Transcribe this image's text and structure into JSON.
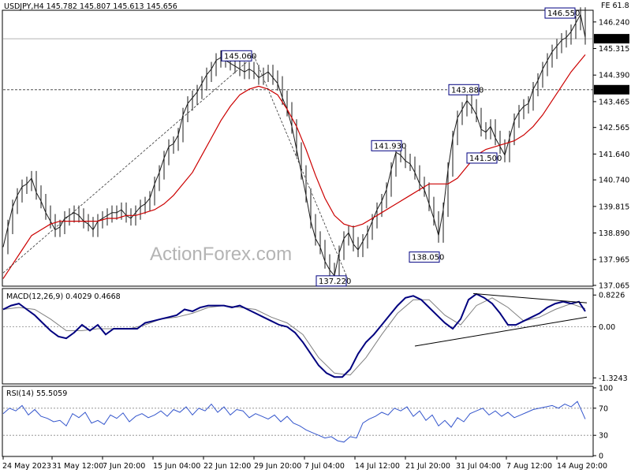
{
  "header": {
    "title": "USDJPY,H4  145.782 145.807 145.613 145.656",
    "fe_label": "FE 61.8"
  },
  "watermark": "ActionForex.com",
  "colors": {
    "price": "#1a1a1a",
    "ma": "#cc0000",
    "macd": "#00007f",
    "macd_signal": "#808080",
    "rsi": "#3355cc",
    "callout_border": "#000080"
  },
  "chart_data": [
    {
      "type": "line",
      "title": "USDJPY,H4",
      "ohlc_last": {
        "open": 145.782,
        "high": 145.807,
        "low": 145.613,
        "close": 145.656
      },
      "ylim": [
        137.065,
        146.62
      ],
      "yticks": [
        {
          "v": 146.24,
          "label": "146.240"
        },
        {
          "v": 145.315,
          "label": "145.315"
        },
        {
          "v": 144.39,
          "label": "144.390"
        },
        {
          "v": 143.465,
          "label": "143.465"
        },
        {
          "v": 142.565,
          "label": "142.565"
        },
        {
          "v": 141.64,
          "label": "141.640"
        },
        {
          "v": 140.74,
          "label": "140.740"
        },
        {
          "v": 139.815,
          "label": "139.815"
        },
        {
          "v": 138.89,
          "label": "138.890"
        },
        {
          "v": 137.965,
          "label": "137.965"
        },
        {
          "v": 137.065,
          "label": "137.065"
        }
      ],
      "price_labels": [
        {
          "v": 145.656,
          "label": "145.656"
        },
        {
          "v": 143.88,
          "label": "143.880"
        }
      ],
      "xlabels": [
        "24 May 2023",
        "31 May 12:00",
        "7 Jun 20:00",
        "15 Jun 04:00",
        "22 Jun 12:00",
        "29 Jun 20:00",
        "7 Jul 04:00",
        "14 Jul 12:00",
        "21 Jul 20:00",
        "31 Jul 04:00",
        "7 Aug 12:00",
        "14 Aug 20:00"
      ],
      "callouts": [
        {
          "label": "145.060",
          "v": 145.06
        },
        {
          "label": "137.220",
          "v": 137.22
        },
        {
          "label": "141.930",
          "v": 141.93
        },
        {
          "label": "138.050",
          "v": 138.05
        },
        {
          "label": "143.880",
          "v": 143.88
        },
        {
          "label": "141.500",
          "v": 141.5
        },
        {
          "label": "146.550",
          "v": 146.55
        }
      ],
      "series": [
        {
          "name": "USDJPY",
          "x": [
            0,
            6,
            12,
            18,
            24,
            30,
            36,
            42,
            48,
            54,
            60,
            66,
            72,
            78,
            84,
            90,
            96,
            102,
            108,
            114,
            120,
            126,
            132,
            138,
            144,
            150,
            156,
            162,
            168,
            174,
            180,
            186,
            192,
            198,
            204,
            210,
            216,
            222,
            228,
            234,
            240,
            246,
            252,
            258,
            264,
            270,
            276,
            282,
            288,
            294,
            300,
            306,
            312,
            318,
            324,
            330,
            336,
            342,
            348,
            354,
            360,
            366,
            372,
            378,
            384,
            390,
            396,
            402,
            408,
            414,
            420,
            426,
            432,
            438,
            444,
            450,
            456,
            462,
            468,
            474,
            480,
            486,
            492,
            498,
            504,
            510,
            516,
            522,
            528,
            534,
            540,
            546,
            552,
            558,
            564,
            570,
            576,
            582,
            588,
            594,
            600,
            606,
            612,
            618,
            624,
            630,
            636,
            642,
            648,
            654,
            660,
            666,
            672,
            678,
            684,
            690,
            696,
            702,
            708,
            714,
            720,
            726,
            732,
            738
          ],
          "values": [
            138.4,
            139.1,
            139.8,
            140.2,
            140.5,
            140.6,
            140.8,
            140.3,
            140.0,
            139.6,
            139.3,
            139.0,
            139.1,
            139.4,
            139.5,
            139.6,
            139.5,
            139.3,
            139.2,
            139.0,
            139.3,
            139.4,
            139.5,
            139.6,
            139.6,
            139.7,
            139.5,
            139.4,
            139.6,
            139.8,
            139.9,
            140.1,
            140.6,
            141.0,
            141.5,
            141.9,
            142.0,
            142.3,
            143.0,
            143.4,
            143.6,
            143.8,
            144.1,
            144.4,
            144.6,
            144.9,
            145.0,
            144.9,
            144.8,
            144.7,
            144.6,
            144.5,
            144.6,
            144.5,
            144.3,
            144.4,
            144.5,
            144.3,
            144.1,
            143.6,
            143.2,
            142.6,
            141.8,
            141.0,
            140.2,
            139.3,
            138.7,
            138.4,
            137.9,
            137.6,
            137.4,
            138.2,
            138.7,
            138.9,
            138.5,
            138.3,
            138.6,
            138.9,
            139.3,
            139.7,
            140.0,
            140.4,
            141.1,
            141.7,
            141.6,
            141.4,
            141.3,
            141.0,
            140.6,
            140.4,
            139.9,
            139.4,
            138.8,
            139.7,
            141.1,
            142.2,
            142.9,
            143.2,
            143.5,
            143.3,
            143.0,
            142.5,
            142.4,
            142.6,
            142.2,
            141.9,
            141.6,
            142.2,
            142.8,
            143.1,
            143.3,
            143.4,
            143.9,
            144.2,
            144.6,
            144.9,
            145.2,
            145.4,
            145.6,
            145.7,
            145.9,
            146.2,
            146.5,
            145.7
          ]
        },
        {
          "name": "MA",
          "x": [
            0,
            12,
            24,
            36,
            48,
            60,
            72,
            84,
            96,
            108,
            120,
            132,
            144,
            156,
            168,
            180,
            192,
            204,
            216,
            228,
            240,
            252,
            264,
            276,
            288,
            300,
            312,
            324,
            336,
            348,
            360,
            372,
            384,
            396,
            408,
            420,
            432,
            444,
            456,
            468,
            480,
            492,
            504,
            516,
            528,
            540,
            552,
            564,
            576,
            588,
            600,
            612,
            624,
            636,
            648,
            660,
            672,
            684,
            696,
            708,
            720,
            732,
            738
          ],
          "values": [
            137.3,
            137.8,
            138.3,
            138.8,
            139.0,
            139.2,
            139.3,
            139.3,
            139.3,
            139.3,
            139.3,
            139.4,
            139.4,
            139.5,
            139.5,
            139.6,
            139.7,
            139.9,
            140.2,
            140.6,
            141.0,
            141.6,
            142.2,
            142.8,
            143.3,
            143.7,
            143.9,
            144.0,
            143.9,
            143.7,
            143.2,
            142.6,
            141.8,
            140.9,
            140.1,
            139.5,
            139.2,
            139.1,
            139.2,
            139.4,
            139.6,
            139.8,
            140.0,
            140.2,
            140.4,
            140.6,
            140.6,
            140.6,
            140.8,
            141.2,
            141.6,
            141.8,
            141.9,
            142.0,
            142.1,
            142.3,
            142.6,
            143.0,
            143.5,
            144.0,
            144.5,
            144.9,
            145.1
          ]
        }
      ]
    },
    {
      "type": "line",
      "title": "MACD(12,26,9) 0.4029 0.4668",
      "ylim": [
        -1.46,
        0.95
      ],
      "yticks": [
        {
          "v": 0.8226,
          "label": "0.8226"
        },
        {
          "v": 0.0,
          "label": "0.00"
        },
        {
          "v": -1.3243,
          "label": "-1.3243"
        }
      ],
      "series": [
        {
          "name": "MACD",
          "x": [
            0,
            10,
            20,
            30,
            40,
            50,
            60,
            70,
            80,
            90,
            100,
            110,
            120,
            130,
            140,
            150,
            160,
            170,
            180,
            190,
            200,
            210,
            220,
            230,
            240,
            250,
            260,
            270,
            280,
            290,
            300,
            310,
            320,
            330,
            340,
            350,
            360,
            370,
            380,
            390,
            400,
            410,
            420,
            430,
            440,
            450,
            460,
            470,
            480,
            490,
            500,
            510,
            520,
            530,
            540,
            550,
            560,
            570,
            580,
            590,
            600,
            610,
            620,
            630,
            640,
            650,
            660,
            670,
            680,
            690,
            700,
            710,
            720,
            730,
            738
          ],
          "values": [
            0.45,
            0.55,
            0.6,
            0.45,
            0.3,
            0.1,
            -0.1,
            -0.25,
            -0.3,
            -0.15,
            0.05,
            -0.1,
            0.05,
            -0.2,
            -0.05,
            -0.05,
            -0.05,
            -0.05,
            0.1,
            0.15,
            0.2,
            0.25,
            0.3,
            0.45,
            0.4,
            0.5,
            0.55,
            0.55,
            0.55,
            0.5,
            0.55,
            0.45,
            0.35,
            0.25,
            0.15,
            0.05,
            0.0,
            -0.15,
            -0.4,
            -0.7,
            -1.0,
            -1.2,
            -1.3,
            -1.3,
            -1.1,
            -0.7,
            -0.4,
            -0.2,
            0.05,
            0.3,
            0.55,
            0.75,
            0.8,
            0.7,
            0.5,
            0.3,
            0.1,
            -0.05,
            0.2,
            0.7,
            0.85,
            0.75,
            0.6,
            0.35,
            0.05,
            0.05,
            0.15,
            0.25,
            0.35,
            0.5,
            0.6,
            0.65,
            0.6,
            0.65,
            0.4
          ]
        },
        {
          "name": "Signal",
          "x": [
            0,
            20,
            40,
            60,
            80,
            100,
            120,
            140,
            160,
            180,
            200,
            220,
            240,
            260,
            280,
            300,
            320,
            340,
            360,
            380,
            400,
            420,
            440,
            460,
            480,
            500,
            520,
            540,
            560,
            580,
            600,
            620,
            640,
            660,
            680,
            700,
            720,
            738
          ],
          "values": [
            0.45,
            0.5,
            0.45,
            0.2,
            -0.1,
            -0.1,
            -0.05,
            -0.05,
            -0.05,
            0.05,
            0.2,
            0.25,
            0.35,
            0.5,
            0.55,
            0.5,
            0.45,
            0.25,
            0.1,
            -0.2,
            -0.8,
            -1.2,
            -1.25,
            -0.8,
            -0.2,
            0.35,
            0.7,
            0.7,
            0.3,
            0.05,
            0.55,
            0.75,
            0.5,
            0.15,
            0.25,
            0.45,
            0.6,
            0.47
          ]
        }
      ]
    },
    {
      "type": "line",
      "title": "RSI(14) 55.5059",
      "ylim": [
        0,
        100
      ],
      "yticks": [
        {
          "v": 100,
          "label": "100"
        },
        {
          "v": 70,
          "label": "70"
        },
        {
          "v": 30,
          "label": "30"
        },
        {
          "v": 0,
          "label": "0"
        }
      ],
      "series": [
        {
          "name": "RSI",
          "x": [
            0,
            8,
            16,
            24,
            32,
            40,
            48,
            56,
            64,
            72,
            80,
            88,
            96,
            104,
            112,
            120,
            128,
            136,
            144,
            152,
            160,
            168,
            176,
            184,
            192,
            200,
            208,
            216,
            224,
            232,
            240,
            248,
            256,
            264,
            272,
            280,
            288,
            296,
            304,
            312,
            320,
            328,
            336,
            344,
            352,
            360,
            368,
            376,
            384,
            392,
            400,
            408,
            416,
            424,
            432,
            440,
            448,
            456,
            464,
            472,
            480,
            488,
            496,
            504,
            512,
            520,
            528,
            536,
            544,
            552,
            560,
            568,
            576,
            584,
            592,
            600,
            608,
            616,
            624,
            632,
            640,
            648,
            656,
            664,
            672,
            680,
            688,
            696,
            704,
            712,
            720,
            728,
            738
          ],
          "values": [
            62,
            70,
            66,
            74,
            60,
            68,
            58,
            55,
            50,
            52,
            44,
            62,
            56,
            64,
            48,
            52,
            46,
            60,
            55,
            63,
            50,
            58,
            62,
            56,
            60,
            66,
            58,
            68,
            64,
            72,
            60,
            70,
            66,
            76,
            64,
            72,
            60,
            68,
            66,
            56,
            62,
            58,
            54,
            60,
            50,
            58,
            48,
            44,
            38,
            34,
            30,
            26,
            28,
            22,
            20,
            28,
            26,
            48,
            54,
            58,
            64,
            60,
            70,
            66,
            72,
            58,
            66,
            52,
            60,
            44,
            52,
            42,
            56,
            50,
            62,
            66,
            70,
            60,
            66,
            58,
            64,
            56,
            60,
            64,
            68,
            70,
            72,
            74,
            70,
            76,
            72,
            80,
            54
          ]
        }
      ]
    }
  ]
}
